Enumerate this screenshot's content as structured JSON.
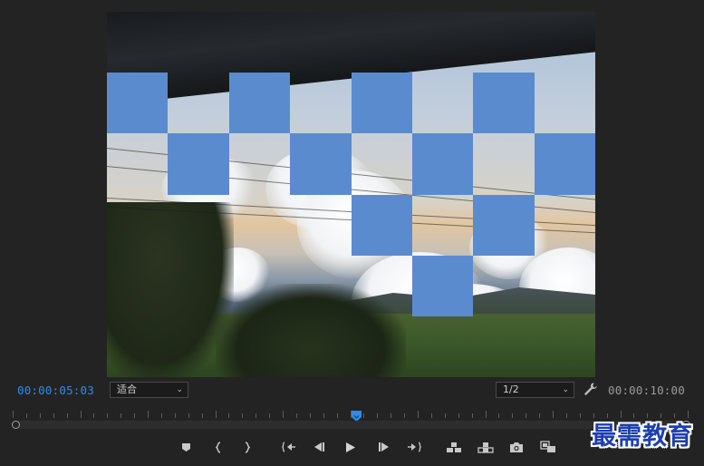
{
  "monitor": {
    "current_timecode": "00:00:05:03",
    "duration_timecode": "00:00:10:00",
    "zoom_select": {
      "value": "适合",
      "icon": "chevron-down-icon"
    },
    "resolution_select": {
      "value": "1/2",
      "icon": "chevron-down-icon"
    },
    "settings_icon": "wrench-icon"
  },
  "transport": {
    "buttons": [
      {
        "name": "add-marker-button",
        "icon": "marker-icon"
      },
      {
        "name": "mark-in-button",
        "icon": "mark-in-icon"
      },
      {
        "name": "mark-out-button",
        "icon": "mark-out-icon"
      },
      {
        "name": "go-to-in-button",
        "icon": "go-to-in-icon"
      },
      {
        "name": "step-back-button",
        "icon": "step-back-icon"
      },
      {
        "name": "play-button",
        "icon": "play-icon"
      },
      {
        "name": "step-forward-button",
        "icon": "step-forward-icon"
      },
      {
        "name": "go-to-out-button",
        "icon": "go-to-out-icon"
      },
      {
        "name": "insert-button",
        "icon": "insert-icon"
      },
      {
        "name": "overwrite-button",
        "icon": "overwrite-icon"
      },
      {
        "name": "export-frame-button",
        "icon": "camera-icon"
      },
      {
        "name": "comparison-view-button",
        "icon": "comparison-icon"
      }
    ]
  },
  "playhead": {
    "position_fraction": 0.51
  },
  "colors": {
    "timecode_blue": "#2d8ceb",
    "checker_blue": "#5b8bcf",
    "background": "#232323",
    "watermark": "#1d3fb0"
  },
  "watermark": {
    "text": "最需教育"
  }
}
